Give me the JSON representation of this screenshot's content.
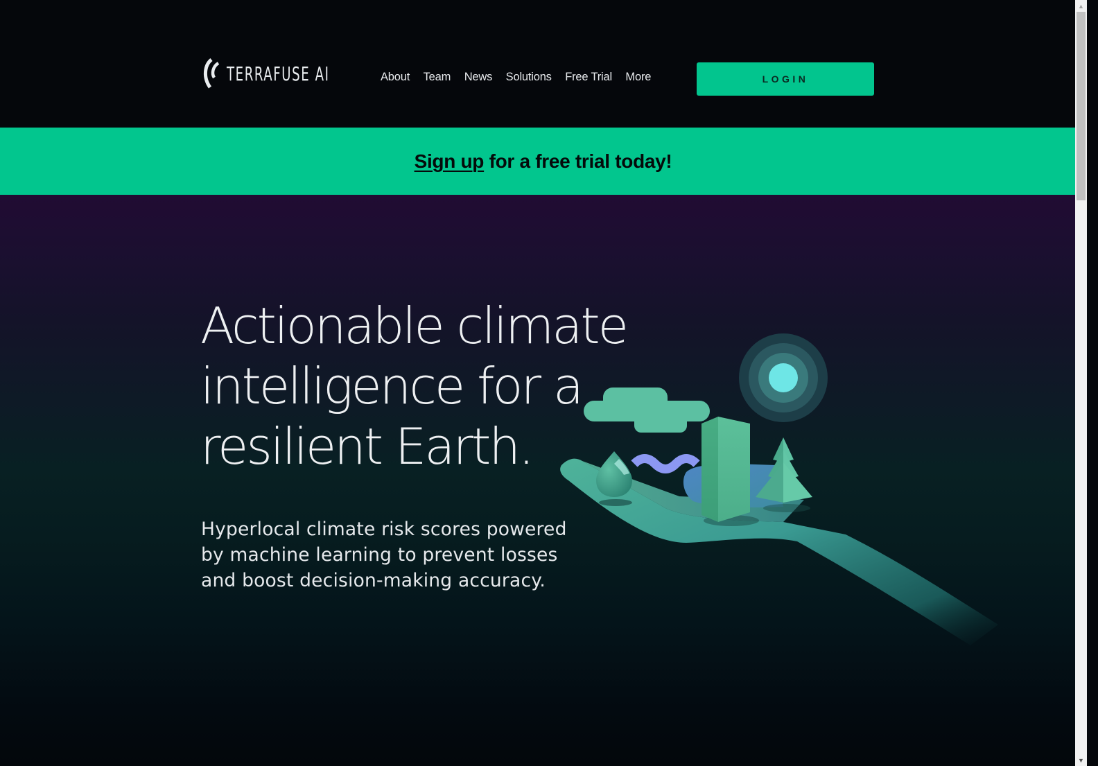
{
  "brand": {
    "name": "TERRAFUSE AI",
    "logo_icon": "signal-arcs-icon"
  },
  "nav": {
    "items": [
      {
        "label": "About"
      },
      {
        "label": "Team"
      },
      {
        "label": "News"
      },
      {
        "label": "Solutions"
      },
      {
        "label": "Free Trial"
      },
      {
        "label": "More"
      }
    ],
    "login_label": "LOGIN"
  },
  "banner": {
    "link_text": "Sign up",
    "rest_text": " for a free trial today!"
  },
  "hero": {
    "title_lines": [
      "Actionable climate",
      "intelligence for a",
      "resilient Earth."
    ],
    "subtitle_lines": [
      "Hyperlocal climate risk scores powered",
      "by machine learning to prevent losses",
      "and boost decision-making accuracy."
    ],
    "illustration": {
      "description": "hand holding cloud, water drop, wave, building, tree and sun",
      "elements": [
        "hand",
        "cloud",
        "water-drop",
        "wave",
        "building",
        "tree",
        "sun"
      ]
    }
  },
  "colors": {
    "accent": "#02c68e",
    "header_bg": "#05070b",
    "hero_top": "#210b33",
    "hero_bottom": "#03070b",
    "text_light": "#eef0f2",
    "sun_core": "#6ee6e6",
    "wave": "#8c98f2"
  },
  "scrollbar": {
    "up_icon": "scroll-up-arrow-icon",
    "down_icon": "scroll-down-arrow-icon"
  }
}
